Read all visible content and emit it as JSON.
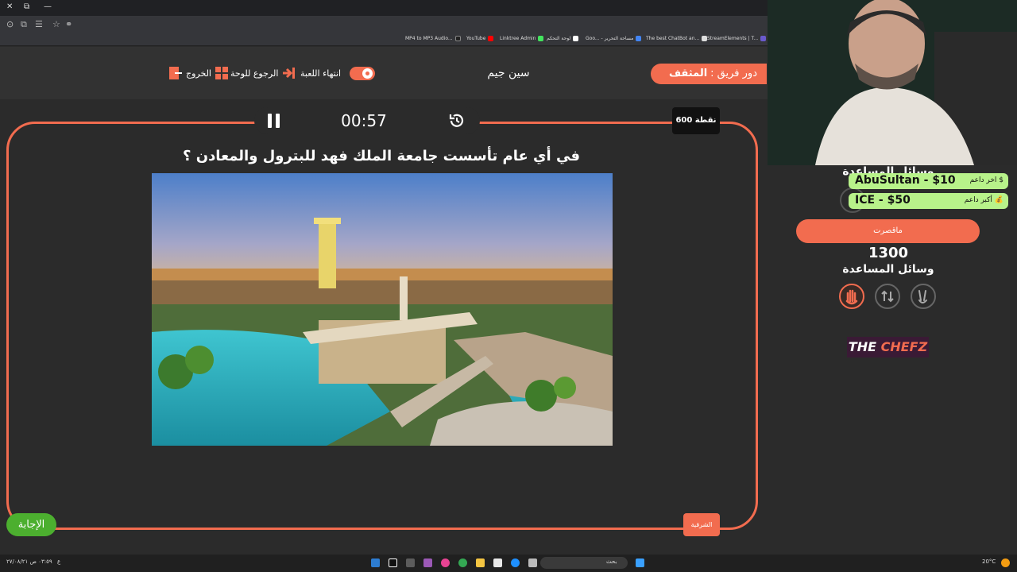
{
  "browser": {
    "bookmarks": [
      "MP4 to MP3 Audio...",
      "YouTube",
      "Linktree Admin",
      "لوحة التحكم",
      "Goo... - مساحة التحرير",
      "The best ChatBot an...",
      "StreamElements | T..."
    ]
  },
  "header": {
    "team_prefix": "دور فريق :",
    "team_name": "المثقف",
    "game_title": "سين جيم",
    "end_game": "انتهاء اللعبة",
    "back_to_board": "الرجوع للوحة",
    "exit": "الخروج"
  },
  "game": {
    "timer": "00:57",
    "points": "600 نقطة",
    "question": "في أي عام تأسست جامعة الملك فهد للبترول والمعادن ؟",
    "answer_button": "الإجابة",
    "team_tag": "الشرقية"
  },
  "side": {
    "helpers_title_top": "وسائل المساعدة",
    "last_donor_label": "$ اخر داعم",
    "last_donor_value": "AbuSultan - $10",
    "top_donor_label": "💰 أكبر داعم",
    "top_donor_value": "ICE - $50",
    "team_button": "ماقصرت",
    "score": "1300",
    "helpers_title": "وسائل المساعدة",
    "helper_icons": [
      "hand-icon",
      "swap-icon",
      "two-fingers-icon"
    ],
    "logo_the": "THE",
    "logo_chefz": "CHEFZ"
  },
  "taskbar": {
    "search_placeholder": "بحث",
    "weather": "20°C",
    "weather_desc": "مشمس",
    "time": "٠٣:٥٩ ص",
    "date": "٢٧/٠٨/٢١",
    "lang": "ع"
  },
  "colors": {
    "accent": "#f26c4f",
    "answer_green": "#4caf2f",
    "donor_green": "#b8f28a"
  }
}
